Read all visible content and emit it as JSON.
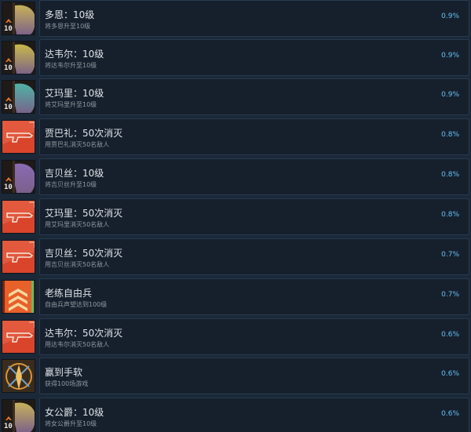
{
  "achievements": [
    {
      "title": "多恩：10级",
      "description": "将多恩升至10级",
      "percent": "0.9%",
      "icon": "level-icon",
      "level_label": "10",
      "color": "#c7b15a"
    },
    {
      "title": "达韦尔：10级",
      "description": "将达韦尔升至10级",
      "percent": "0.9%",
      "icon": "level-icon",
      "level_label": "10",
      "color": "#c9b84a"
    },
    {
      "title": "艾玛里：10级",
      "description": "将艾玛里升至10级",
      "percent": "0.9%",
      "icon": "level-icon",
      "level_label": "10",
      "color": "#4fb3a6"
    },
    {
      "title": "贾巴礼：50次消灭",
      "description": "用贾巴礼消灭50名敌人",
      "percent": "0.8%",
      "icon": "kill-icon",
      "color": "#d9452b"
    },
    {
      "title": "吉贝丝：10级",
      "description": "将吉贝丝升至10级",
      "percent": "0.8%",
      "icon": "level-icon",
      "level_label": "10",
      "color": "#8a6bb3"
    },
    {
      "title": "艾玛里：50次消灭",
      "description": "用艾玛里消灭50名敌人",
      "percent": "0.8%",
      "icon": "kill-icon",
      "color": "#d9452b"
    },
    {
      "title": "吉贝丝：50次消灭",
      "description": "用吉贝丝消灭50名敌人",
      "percent": "0.7%",
      "icon": "kill-icon",
      "color": "#d9452b"
    },
    {
      "title": "老练自由兵",
      "description": "自由兵声望达到100级",
      "percent": "0.7%",
      "icon": "veteran-icon",
      "color": "#e8602a"
    },
    {
      "title": "达韦尔：50次消灭",
      "description": "用达韦尔消灭50名敌人",
      "percent": "0.6%",
      "icon": "kill-icon",
      "color": "#d9452b"
    },
    {
      "title": "赢到手软",
      "description": "获得100场游戏",
      "percent": "0.6%",
      "icon": "win-icon",
      "color": "#e0a03a"
    },
    {
      "title": "女公爵：10级",
      "description": "将女公爵升至10级",
      "percent": "0.6%",
      "icon": "level-icon",
      "level_label": "10",
      "color": "#c7b15a"
    }
  ]
}
